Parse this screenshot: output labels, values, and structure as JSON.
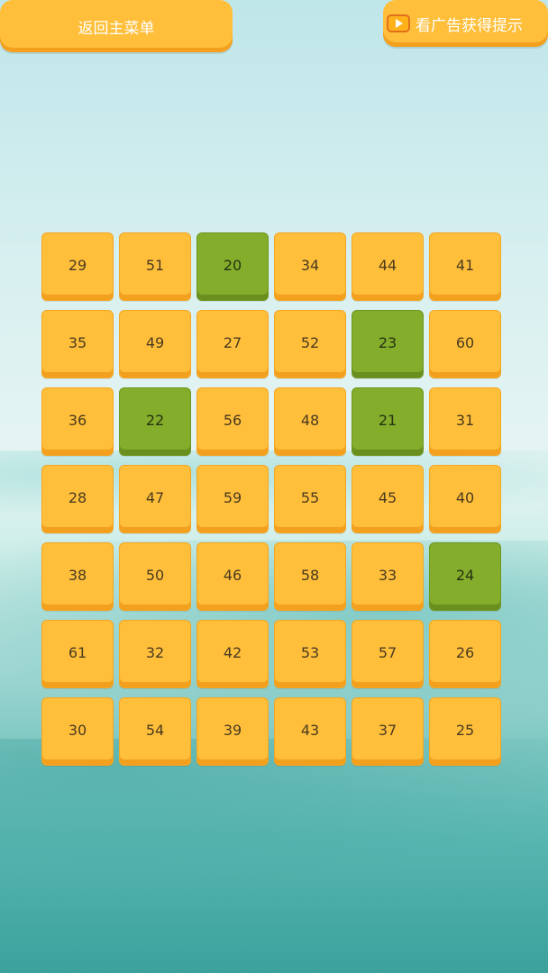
{
  "header": {
    "back_label": "返回主菜单",
    "hint_label": "看广告获得提示",
    "hint_icon": "video-play-icon"
  },
  "colors": {
    "tile": "#ffbf3b",
    "tile_selected": "#83ad2a"
  },
  "board": {
    "columns": 6,
    "rows": [
      [
        {
          "value": "29",
          "selected": false
        },
        {
          "value": "51",
          "selected": false
        },
        {
          "value": "20",
          "selected": true
        },
        {
          "value": "34",
          "selected": false
        },
        {
          "value": "44",
          "selected": false
        },
        {
          "value": "41",
          "selected": false
        }
      ],
      [
        {
          "value": "35",
          "selected": false
        },
        {
          "value": "49",
          "selected": false
        },
        {
          "value": "27",
          "selected": false
        },
        {
          "value": "52",
          "selected": false
        },
        {
          "value": "23",
          "selected": true
        },
        {
          "value": "60",
          "selected": false
        }
      ],
      [
        {
          "value": "36",
          "selected": false
        },
        {
          "value": "22",
          "selected": true
        },
        {
          "value": "56",
          "selected": false
        },
        {
          "value": "48",
          "selected": false
        },
        {
          "value": "21",
          "selected": true
        },
        {
          "value": "31",
          "selected": false
        }
      ],
      [
        {
          "value": "28",
          "selected": false
        },
        {
          "value": "47",
          "selected": false
        },
        {
          "value": "59",
          "selected": false
        },
        {
          "value": "55",
          "selected": false
        },
        {
          "value": "45",
          "selected": false
        },
        {
          "value": "40",
          "selected": false
        }
      ],
      [
        {
          "value": "38",
          "selected": false
        },
        {
          "value": "50",
          "selected": false
        },
        {
          "value": "46",
          "selected": false
        },
        {
          "value": "58",
          "selected": false
        },
        {
          "value": "33",
          "selected": false
        },
        {
          "value": "24",
          "selected": true
        }
      ],
      [
        {
          "value": "61",
          "selected": false
        },
        {
          "value": "32",
          "selected": false
        },
        {
          "value": "42",
          "selected": false
        },
        {
          "value": "53",
          "selected": false
        },
        {
          "value": "57",
          "selected": false
        },
        {
          "value": "26",
          "selected": false
        }
      ],
      [
        {
          "value": "30",
          "selected": false
        },
        {
          "value": "54",
          "selected": false
        },
        {
          "value": "39",
          "selected": false
        },
        {
          "value": "43",
          "selected": false
        },
        {
          "value": "37",
          "selected": false
        },
        {
          "value": "25",
          "selected": false
        }
      ]
    ]
  }
}
